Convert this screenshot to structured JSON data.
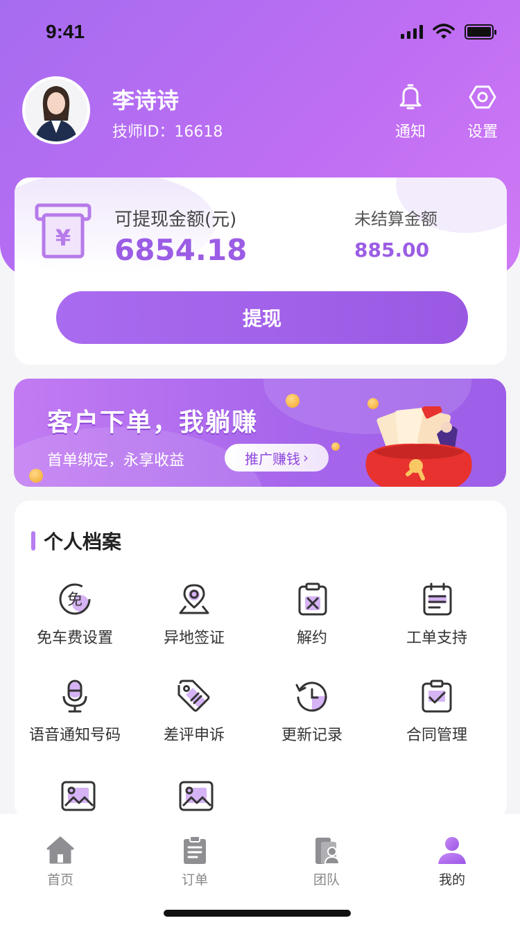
{
  "status_bar": {
    "time": "9:41"
  },
  "user": {
    "name": "李诗诗",
    "id_label": "技师ID：16618"
  },
  "header_actions": {
    "notify_label": "通知",
    "settings_label": "设置"
  },
  "wallet": {
    "withdrawable_label": "可提现金额(元)",
    "withdrawable_amount": "6854.18",
    "unsettled_label": "未结算金额",
    "unsettled_amount": "885.00",
    "withdraw_button": "提现",
    "icon": "atm-yuan-icon"
  },
  "promo": {
    "title": "客户下单，我躺赚",
    "subtitle": "首单绑定，永享收益",
    "button": "推广赚钱",
    "icon": "red-lucky-bag-icon"
  },
  "profile": {
    "title": "个人档案",
    "items": [
      {
        "label": "免车费设置",
        "icon": "free-fare-icon"
      },
      {
        "label": "异地签证",
        "icon": "location-pin-icon"
      },
      {
        "label": "解约",
        "icon": "cancel-contract-icon"
      },
      {
        "label": "工单支持",
        "icon": "work-order-icon"
      },
      {
        "label": "语音通知号码",
        "icon": "microphone-icon"
      },
      {
        "label": "差评申诉",
        "icon": "tag-icon"
      },
      {
        "label": "更新记录",
        "icon": "history-clock-icon"
      },
      {
        "label": "合同管理",
        "icon": "contract-check-icon"
      },
      {
        "label": "",
        "icon": "image-icon"
      },
      {
        "label": "",
        "icon": "image-icon"
      }
    ]
  },
  "tabbar": {
    "tabs": [
      {
        "label": "首页",
        "icon": "home-icon",
        "active": false
      },
      {
        "label": "订单",
        "icon": "order-doc-icon",
        "active": false
      },
      {
        "label": "团队",
        "icon": "team-icon",
        "active": false
      },
      {
        "label": "我的",
        "icon": "user-icon",
        "active": true
      }
    ]
  },
  "colors": {
    "brand": "#a66cf0",
    "accent": "#9b5de5",
    "coin": "#f3a524",
    "bag": "#e8322f"
  }
}
